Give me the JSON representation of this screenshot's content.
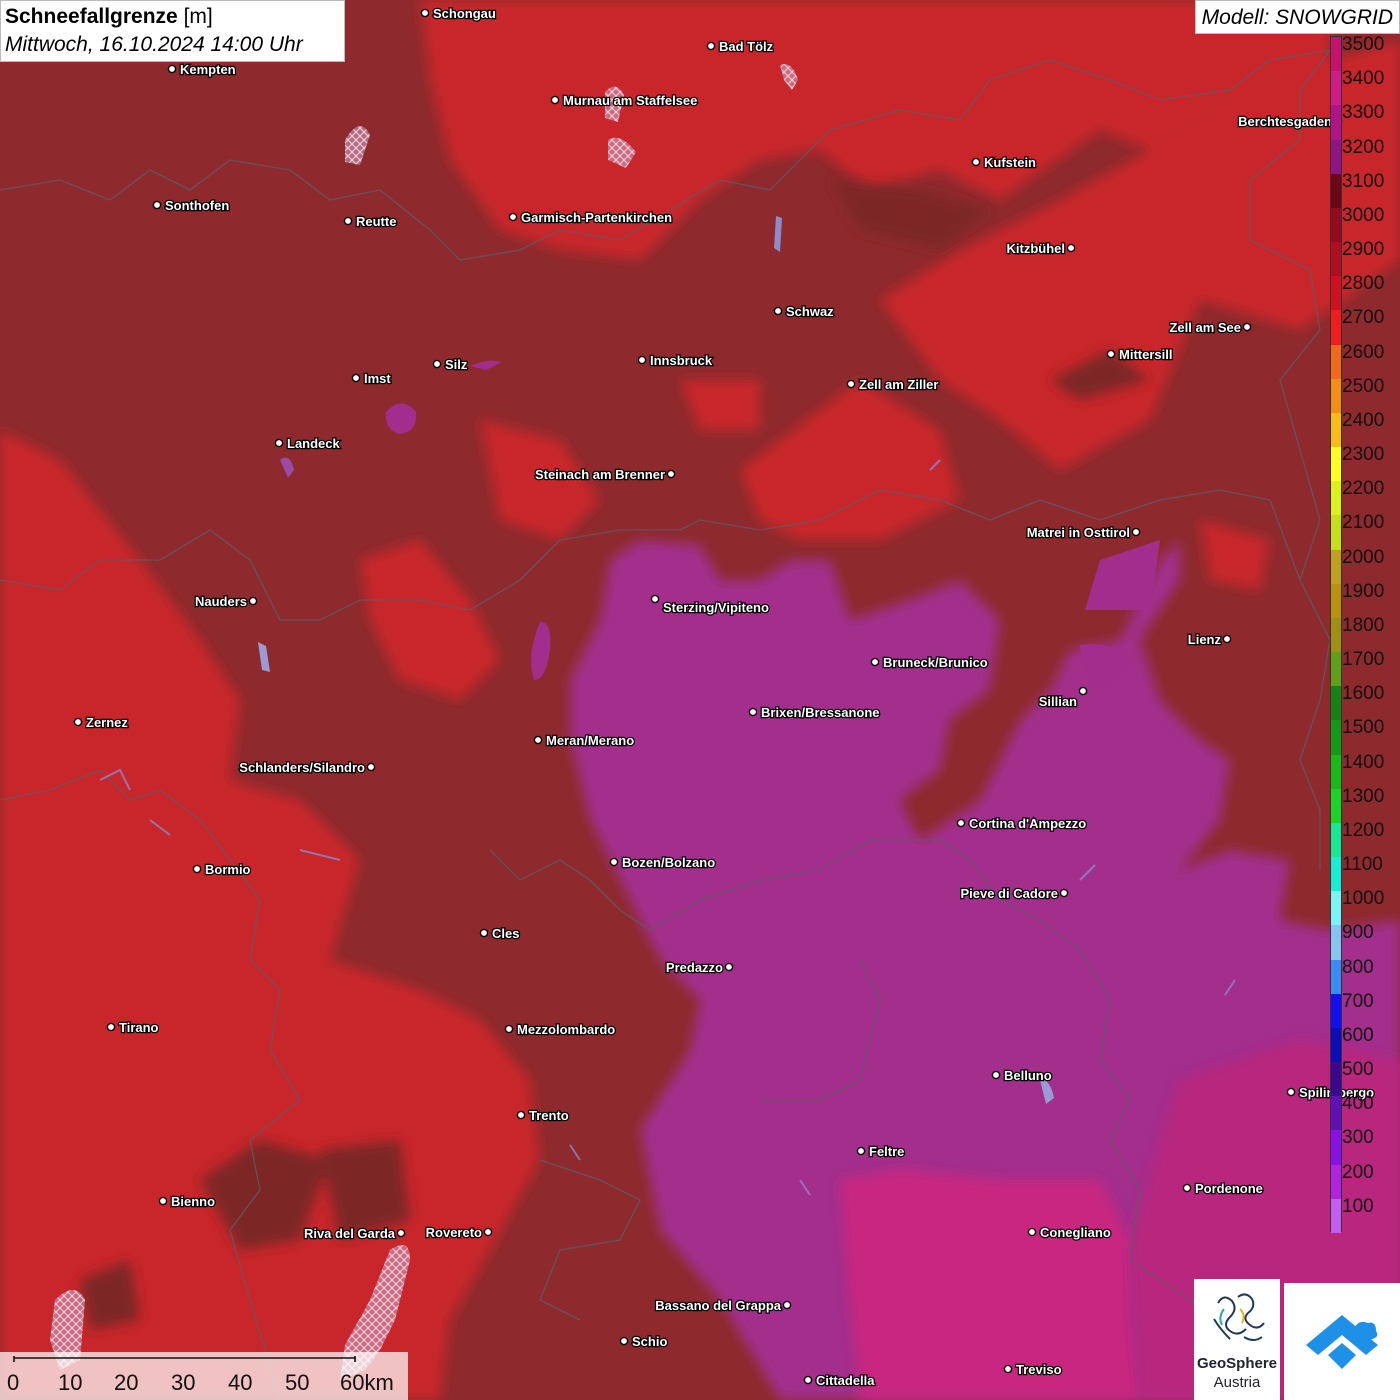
{
  "header": {
    "title_bold": "Schneefallgrenze",
    "title_unit": "[m]",
    "datetime": "Mittwoch, 16.10.2024 14:00 Uhr"
  },
  "model_label": "Modell: SNOWGRID",
  "legend": {
    "labels": [
      "3500",
      "3400",
      "3300",
      "3200",
      "3100",
      "3000",
      "2900",
      "2800",
      "2700",
      "2600",
      "2500",
      "2400",
      "2300",
      "2200",
      "2100",
      "2000",
      "1900",
      "1800",
      "1700",
      "1600",
      "1500",
      "1400",
      "1300",
      "1200",
      "1100",
      "1000",
      "900",
      "800",
      "700",
      "600",
      "500",
      "400",
      "300",
      "200",
      "100"
    ],
    "colors": [
      "#c8116f",
      "#d01c86",
      "#b01488",
      "#8f1484",
      "#6e0618",
      "#950a1c",
      "#b00d1e",
      "#d0101f",
      "#f21c1c",
      "#f2691b",
      "#f58e13",
      "#f9bc16",
      "#ffff1f",
      "#dcf01a",
      "#c4de1a",
      "#c0a020",
      "#b8910e",
      "#a09012",
      "#60a018",
      "#188218",
      "#159a15",
      "#1ab818",
      "#1ad428",
      "#18e896",
      "#18ecd4",
      "#78f4f4",
      "#88c4f2",
      "#3a8cf2",
      "#1010f0",
      "#0c0cb8",
      "#3c0890",
      "#6010b8",
      "#8a10e8",
      "#b024e0",
      "#c45ef2"
    ]
  },
  "cities": [
    {
      "name": "Schongau",
      "dot": [
        425,
        13
      ],
      "side": "r"
    },
    {
      "name": "Bad Tölz",
      "dot": [
        711,
        46
      ],
      "side": "r"
    },
    {
      "name": "Kempten",
      "dot": [
        172,
        69
      ],
      "side": "r"
    },
    {
      "name": "Murnau am Staffelsee",
      "dot": [
        555,
        100
      ],
      "side": "r"
    },
    {
      "name": "Berchtesgaden",
      "dot": [
        1338,
        121
      ],
      "side": "l"
    },
    {
      "name": "Kufstein",
      "dot": [
        976,
        162
      ],
      "side": "r"
    },
    {
      "name": "Sonthofen",
      "dot": [
        157,
        205
      ],
      "side": "r"
    },
    {
      "name": "Reutte",
      "dot": [
        348,
        221
      ],
      "side": "r"
    },
    {
      "name": "Garmisch-Partenkirchen",
      "dot": [
        513,
        217
      ],
      "side": "r"
    },
    {
      "name": "Kitzbühel",
      "dot": [
        1071,
        248
      ],
      "side": "l"
    },
    {
      "name": "Schwaz",
      "dot": [
        778,
        311
      ],
      "side": "r"
    },
    {
      "name": "Zell am See",
      "dot": [
        1247,
        327
      ],
      "side": "l"
    },
    {
      "name": "Mittersill",
      "dot": [
        1111,
        354
      ],
      "side": "r"
    },
    {
      "name": "Innsbruck",
      "dot": [
        642,
        360
      ],
      "side": "r"
    },
    {
      "name": "Silz",
      "dot": [
        437,
        364
      ],
      "side": "r"
    },
    {
      "name": "Imst",
      "dot": [
        356,
        378
      ],
      "side": "r"
    },
    {
      "name": "Zell am Ziller",
      "dot": [
        851,
        384
      ],
      "side": "r"
    },
    {
      "name": "Landeck",
      "dot": [
        279,
        443
      ],
      "side": "r"
    },
    {
      "name": "Steinach am Brenner",
      "dot": [
        671,
        474
      ],
      "side": "l"
    },
    {
      "name": "Matrei in Osttirol",
      "dot": [
        1136,
        532
      ],
      "side": "l"
    },
    {
      "name": "Nauders",
      "dot": [
        253,
        601
      ],
      "side": "l"
    },
    {
      "name": "Sterzing/Vipiteno",
      "dot": [
        655,
        599
      ],
      "side": "rb"
    },
    {
      "name": "Lienz",
      "dot": [
        1227,
        639
      ],
      "side": "l"
    },
    {
      "name": "Bruneck/Brunico",
      "dot": [
        875,
        662
      ],
      "side": "r"
    },
    {
      "name": "Sillian",
      "dot": [
        1083,
        691
      ],
      "side": "lb"
    },
    {
      "name": "Brixen/Bressanone",
      "dot": [
        753,
        712
      ],
      "side": "r"
    },
    {
      "name": "Zernez",
      "dot": [
        78,
        722
      ],
      "side": "r"
    },
    {
      "name": "Meran/Merano",
      "dot": [
        538,
        740
      ],
      "side": "r"
    },
    {
      "name": "Schlanders/Silandro",
      "dot": [
        371,
        767
      ],
      "side": "l"
    },
    {
      "name": "Cortina d'Ampezzo",
      "dot": [
        961,
        823
      ],
      "side": "r"
    },
    {
      "name": "Bozen/Bolzano",
      "dot": [
        614,
        862
      ],
      "side": "r"
    },
    {
      "name": "Bormio",
      "dot": [
        197,
        869
      ],
      "side": "r"
    },
    {
      "name": "Pieve di Cadore",
      "dot": [
        1064,
        893
      ],
      "side": "l"
    },
    {
      "name": "Cles",
      "dot": [
        484,
        933
      ],
      "side": "r"
    },
    {
      "name": "Predazzo",
      "dot": [
        729,
        967
      ],
      "side": "l"
    },
    {
      "name": "Tirano",
      "dot": [
        111,
        1027
      ],
      "side": "r"
    },
    {
      "name": "Mezzolombardo",
      "dot": [
        509,
        1029
      ],
      "side": "r"
    },
    {
      "name": "Belluno",
      "dot": [
        996,
        1075
      ],
      "side": "r"
    },
    {
      "name": "Spilimbergo",
      "dot": [
        1291,
        1092
      ],
      "side": "r"
    },
    {
      "name": "Trento",
      "dot": [
        521,
        1115
      ],
      "side": "r"
    },
    {
      "name": "Feltre",
      "dot": [
        861,
        1151
      ],
      "side": "r"
    },
    {
      "name": "Pordenone",
      "dot": [
        1187,
        1188
      ],
      "side": "r"
    },
    {
      "name": "Bienno",
      "dot": [
        163,
        1201
      ],
      "side": "r"
    },
    {
      "name": "Riva del Garda",
      "dot": [
        401,
        1233
      ],
      "side": "l"
    },
    {
      "name": "Rovereto",
      "dot": [
        488,
        1232
      ],
      "side": "l"
    },
    {
      "name": "Conegliano",
      "dot": [
        1032,
        1232
      ],
      "side": "r"
    },
    {
      "name": "Bassano del Grappa",
      "dot": [
        787,
        1305
      ],
      "side": "l"
    },
    {
      "name": "Schio",
      "dot": [
        624,
        1341
      ],
      "side": "r"
    },
    {
      "name": "Treviso",
      "dot": [
        1008,
        1369
      ],
      "side": "r"
    },
    {
      "name": "Cittadella",
      "dot": [
        808,
        1380
      ],
      "side": "r"
    }
  ],
  "scale_bar": {
    "labels": [
      "0",
      "10",
      "20",
      "30",
      "40",
      "50",
      "60km"
    ]
  },
  "logos": {
    "geosphere_line1": "GeoSphere",
    "geosphere_line2": "Austria"
  }
}
